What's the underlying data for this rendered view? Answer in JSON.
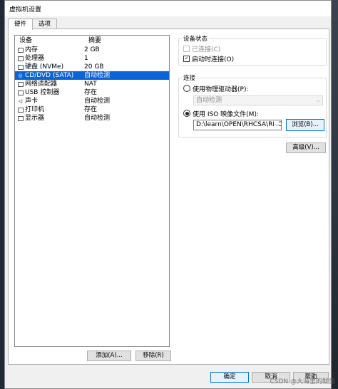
{
  "window": {
    "title": "虚拟机设置"
  },
  "tabs": [
    {
      "label": "硬件",
      "active": true
    },
    {
      "label": "选项",
      "active": false
    }
  ],
  "devices": {
    "headers": {
      "device": "设备",
      "summary": "摘要"
    },
    "rows": [
      {
        "icon": "memory-icon",
        "name": "内存",
        "summary": "2 GB",
        "selected": false
      },
      {
        "icon": "processor-icon",
        "name": "处理器",
        "summary": "1",
        "selected": false
      },
      {
        "icon": "disk-icon",
        "name": "硬盘 (NVMe)",
        "summary": "20 GB",
        "selected": false
      },
      {
        "icon": "cd-icon",
        "name": "CD/DVD (SATA)",
        "summary": "自动检测",
        "selected": true
      },
      {
        "icon": "network-icon",
        "name": "网络适配器",
        "summary": "NAT",
        "selected": false
      },
      {
        "icon": "usb-icon",
        "name": "USB 控制器",
        "summary": "存在",
        "selected": false
      },
      {
        "icon": "sound-icon",
        "name": "声卡",
        "summary": "自动检测",
        "selected": false
      },
      {
        "icon": "printer-icon",
        "name": "打印机",
        "summary": "存在",
        "selected": false
      },
      {
        "icon": "display-icon",
        "name": "显示器",
        "summary": "自动检测",
        "selected": false
      }
    ],
    "add_label": "添加(A)...",
    "remove_label": "移除(R)"
  },
  "device_status": {
    "title": "设备状态",
    "connected_label": "已连接(C)",
    "connected_checked": false,
    "connect_on_power_label": "启动时连接(O)",
    "connect_on_power_checked": true
  },
  "connection": {
    "title": "连接",
    "physical_label": "使用物理驱动器(P):",
    "physical_selected": false,
    "physical_value": "自动检测",
    "iso_label": "使用 ISO 映像文件(M):",
    "iso_selected": true,
    "iso_path": "D:\\learn\\OPEN\\RHCSA\\RHCSA",
    "browse_label": "浏览(B)..."
  },
  "advanced_label": "高级(V)...",
  "footer": {
    "ok_label": "确定",
    "cancel_label": "取消",
    "help_label": "帮助"
  },
  "watermark": "CSDN @大海里的鱿鱼"
}
